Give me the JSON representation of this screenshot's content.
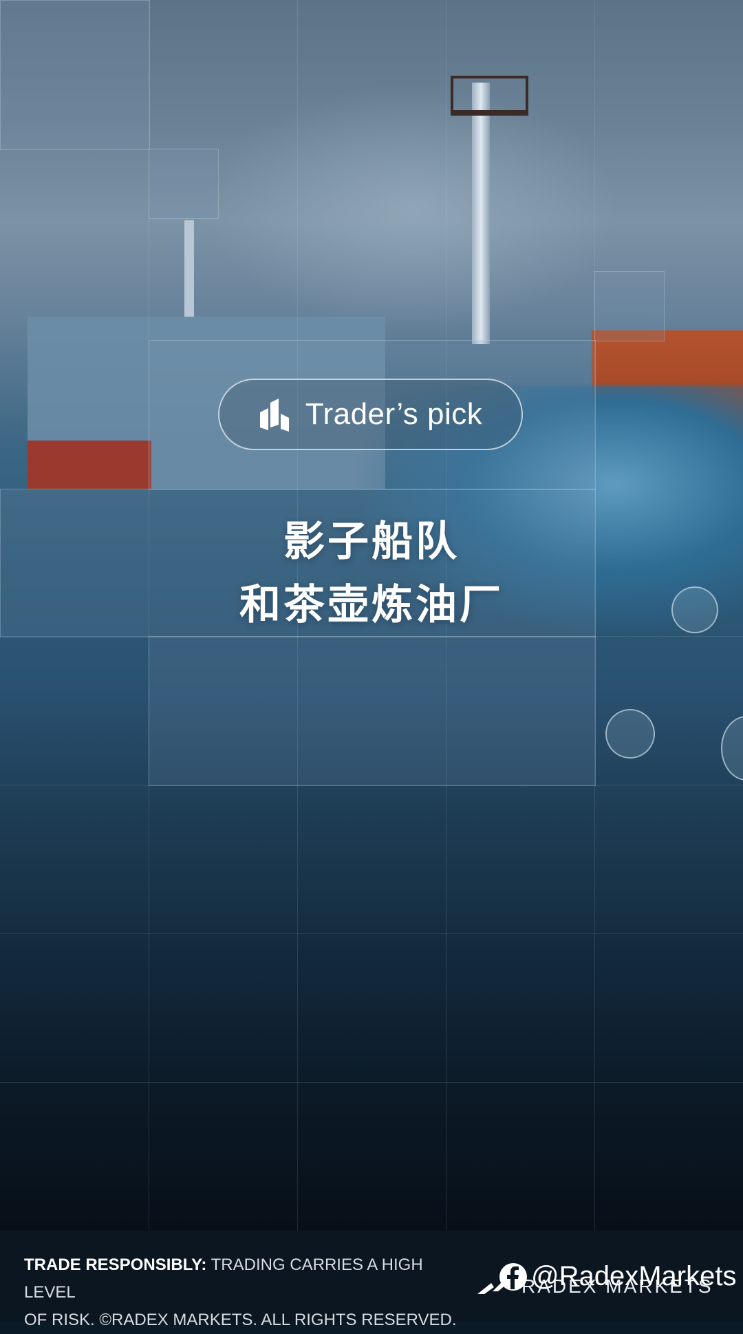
{
  "badge": {
    "label": "Trader’s pick",
    "icon": "bar-chart-icon"
  },
  "headline": {
    "line1": "影子船队",
    "line2": "和茶壶炼油厂"
  },
  "footer": {
    "disclaimer_bold": "TRADE RESPONSIBLY:",
    "disclaimer_line1": "TRADING CARRIES A HIGH LEVEL",
    "disclaimer_line2": "OF RISK.  ©RADEX MARKETS. ALL RIGHTS RESERVED.",
    "brand_name": "RADEX MARKETS",
    "social_handle": "@RadexMarkets",
    "social_icon": "facebook-icon"
  },
  "colors": {
    "accent_white": "#ffffff",
    "footer_bg": "#0b1620",
    "hull_red": "#b5532e"
  }
}
